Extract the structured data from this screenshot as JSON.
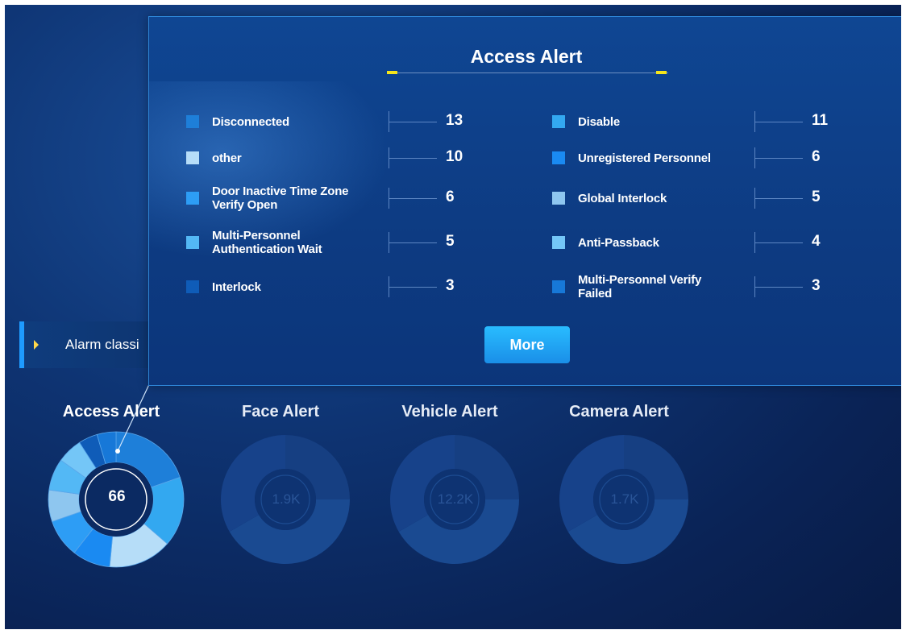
{
  "sidebar_header": {
    "label": "Alarm classi"
  },
  "popup": {
    "title": "Access Alert",
    "more_label": "More",
    "items": [
      {
        "label": "Disconnected",
        "value": "13",
        "color": "#1e7fd9"
      },
      {
        "label": "Disable",
        "value": "11",
        "color": "#33a8f0"
      },
      {
        "label": "other",
        "value": "10",
        "color": "#b6ddf8"
      },
      {
        "label": "Unregistered Personnel",
        "value": "6",
        "color": "#1a8af2"
      },
      {
        "label": "Door Inactive Time Zone Verify Open",
        "value": "6",
        "color": "#2d9df5"
      },
      {
        "label": "Global Interlock",
        "value": "5",
        "color": "#8ec6ef"
      },
      {
        "label": "Multi-Personnel Authentication Wait",
        "value": "5",
        "color": "#53b8f5"
      },
      {
        "label": "Anti-Passback",
        "value": "4",
        "color": "#74c6f7"
      },
      {
        "label": "Interlock",
        "value": "3",
        "color": "#0f5cb8"
      },
      {
        "label": "Multi-Personnel Verify Failed",
        "value": "3",
        "color": "#1778d8"
      }
    ]
  },
  "cards": [
    {
      "title": "Access Alert",
      "value": "66",
      "active": true
    },
    {
      "title": "Face Alert",
      "value": "1.9K",
      "active": false
    },
    {
      "title": "Vehicle Alert",
      "value": "12.2K",
      "active": false
    },
    {
      "title": "Camera Alert",
      "value": "1.7K",
      "active": false
    }
  ]
}
